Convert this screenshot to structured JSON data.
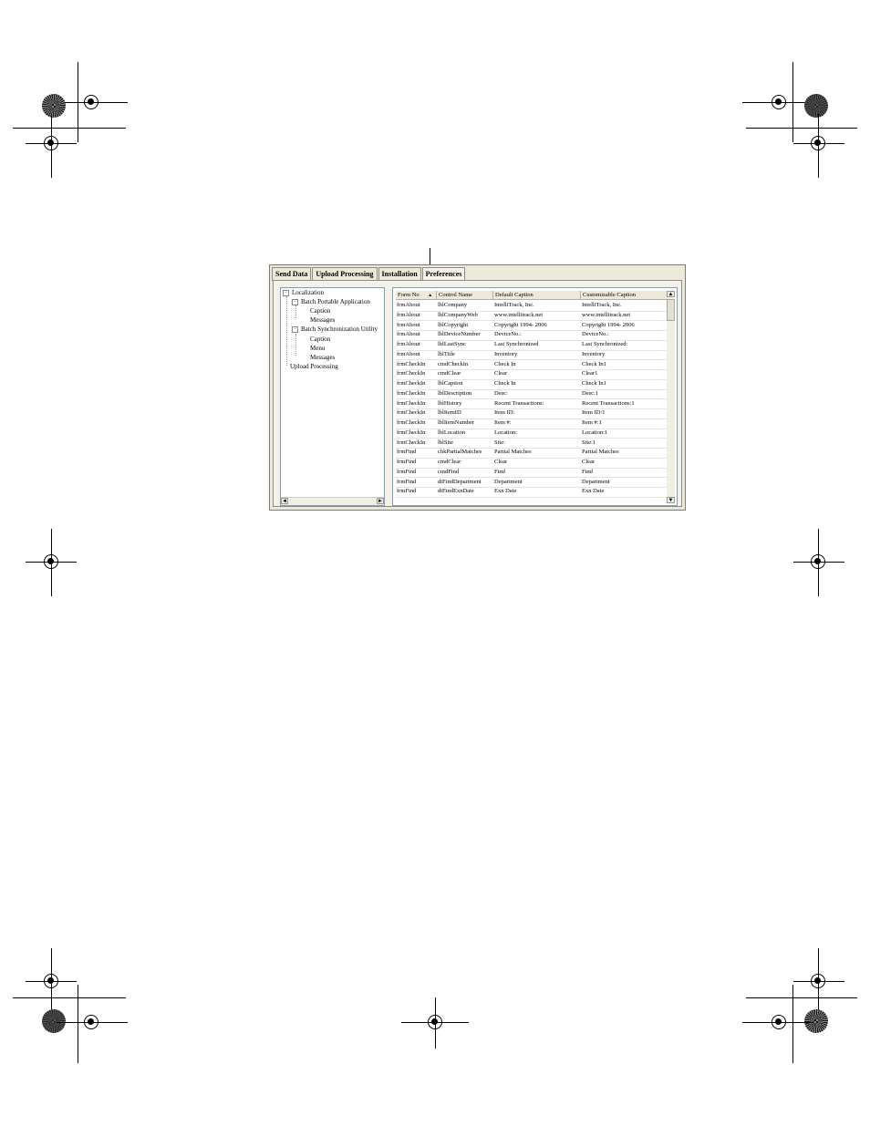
{
  "window": {
    "tabs": [
      {
        "label": "Send Data"
      },
      {
        "label": "Upload Processing"
      },
      {
        "label": "Installation"
      },
      {
        "label": "Preferences"
      }
    ],
    "active_tab": "Preferences"
  },
  "tree": {
    "root": "Localization",
    "groups": [
      {
        "label": "Batch Portable Application",
        "children": [
          "Caption",
          "Messages"
        ]
      },
      {
        "label": "Batch Synchronization Utility",
        "children": [
          "Caption",
          "Menu",
          "Messages"
        ]
      }
    ],
    "extra": "Upload Processing"
  },
  "grid": {
    "columns": [
      "Form No",
      "Control Name",
      "Default Caption",
      "Customizable Caption"
    ],
    "sort_indicator": "▲",
    "rows": [
      [
        "frmAbout",
        "lblCompany",
        "IntelliTrack, Inc.",
        "IntelliTrack, Inc."
      ],
      [
        "frmAbout",
        "lblCompanyWeb",
        "www.intellitrack.net",
        "www.intellitrack.net"
      ],
      [
        "frmAbout",
        "lblCopyright",
        "Copyright 1994- 2006",
        "Copyright 1994- 2006"
      ],
      [
        "frmAbout",
        "lblDeviceNumber",
        "DeviceNo.:",
        "DeviceNo.:"
      ],
      [
        "frmAbout",
        "lblLastSync",
        "Last Synchronized",
        "Last Synchronized:"
      ],
      [
        "frmAbout",
        "lblTitle",
        "Inventory",
        "Inventory"
      ],
      [
        "frmCheckIn",
        "cmdCheckIn",
        "Check In",
        "Check In1"
      ],
      [
        "frmCheckIn",
        "cmdClear",
        "Clear",
        "Clear1"
      ],
      [
        "frmCheckIn",
        "lblCaption",
        "Check In",
        "Check In1"
      ],
      [
        "frmCheckIn",
        "lblDescription",
        "Desc:",
        "Desc:1"
      ],
      [
        "frmCheckIn",
        "lblHistory",
        "Recent Transactions:",
        "Recent Transactions:1"
      ],
      [
        "frmCheckIn",
        "lblItemID",
        "Item ID:",
        "Item ID:1"
      ],
      [
        "frmCheckIn",
        "lblItemNumber",
        "Item #:",
        "Item #:1"
      ],
      [
        "frmCheckIn",
        "lblLocation",
        "Location:",
        "Location:1"
      ],
      [
        "frmCheckIn",
        "lblSite",
        "Site:",
        "Site:1"
      ],
      [
        "frmFind",
        "chkPartialMatches",
        "Partial Matches",
        "Partial Matches"
      ],
      [
        "frmFind",
        "cmdClear",
        "Clear",
        "Clear"
      ],
      [
        "frmFind",
        "cmdFind",
        "Find",
        "Find"
      ],
      [
        "frmFind",
        "dtFindDepartment",
        "Department",
        "Department"
      ],
      [
        "frmFind",
        "dtFindExnDate",
        "Exn Date",
        "Exn Date"
      ]
    ]
  },
  "scroll": {
    "up": "▲",
    "down": "▼",
    "left": "◄",
    "right": "►"
  },
  "icons": {
    "expander": "−"
  }
}
